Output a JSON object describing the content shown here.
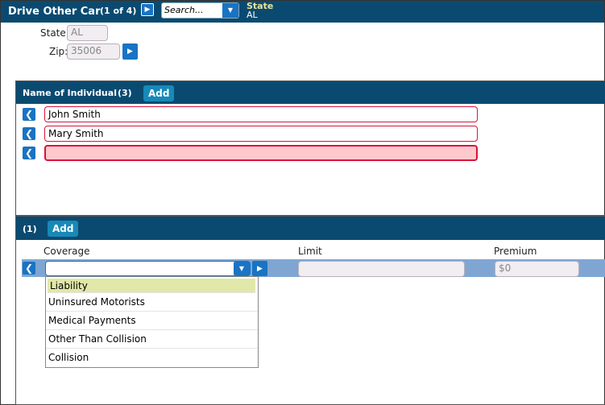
{
  "header": {
    "title": "Drive Other Car",
    "count": "(1 of 4)",
    "search_placeholder": "Search...",
    "state_label": "State",
    "state_value": "AL"
  },
  "form": {
    "state_label": "State:",
    "state_value": "AL",
    "zip_label": "Zip:",
    "zip_value": "35006"
  },
  "individuals": {
    "title": "Name of Individual",
    "count": "(3)",
    "add_label": "Add",
    "names": [
      "John Smith",
      "Mary Smith",
      ""
    ]
  },
  "coverages": {
    "count": "(1)",
    "add_label": "Add",
    "columns": {
      "coverage": "Coverage",
      "limit": "Limit",
      "premium": "Premium"
    },
    "row": {
      "coverage": "",
      "limit": "",
      "premium": "$0"
    },
    "options": [
      "Liability",
      "Uninsured Motorists",
      "Medical Payments",
      "Other Than Collision",
      "Collision"
    ],
    "selected_option": "Liability"
  }
}
